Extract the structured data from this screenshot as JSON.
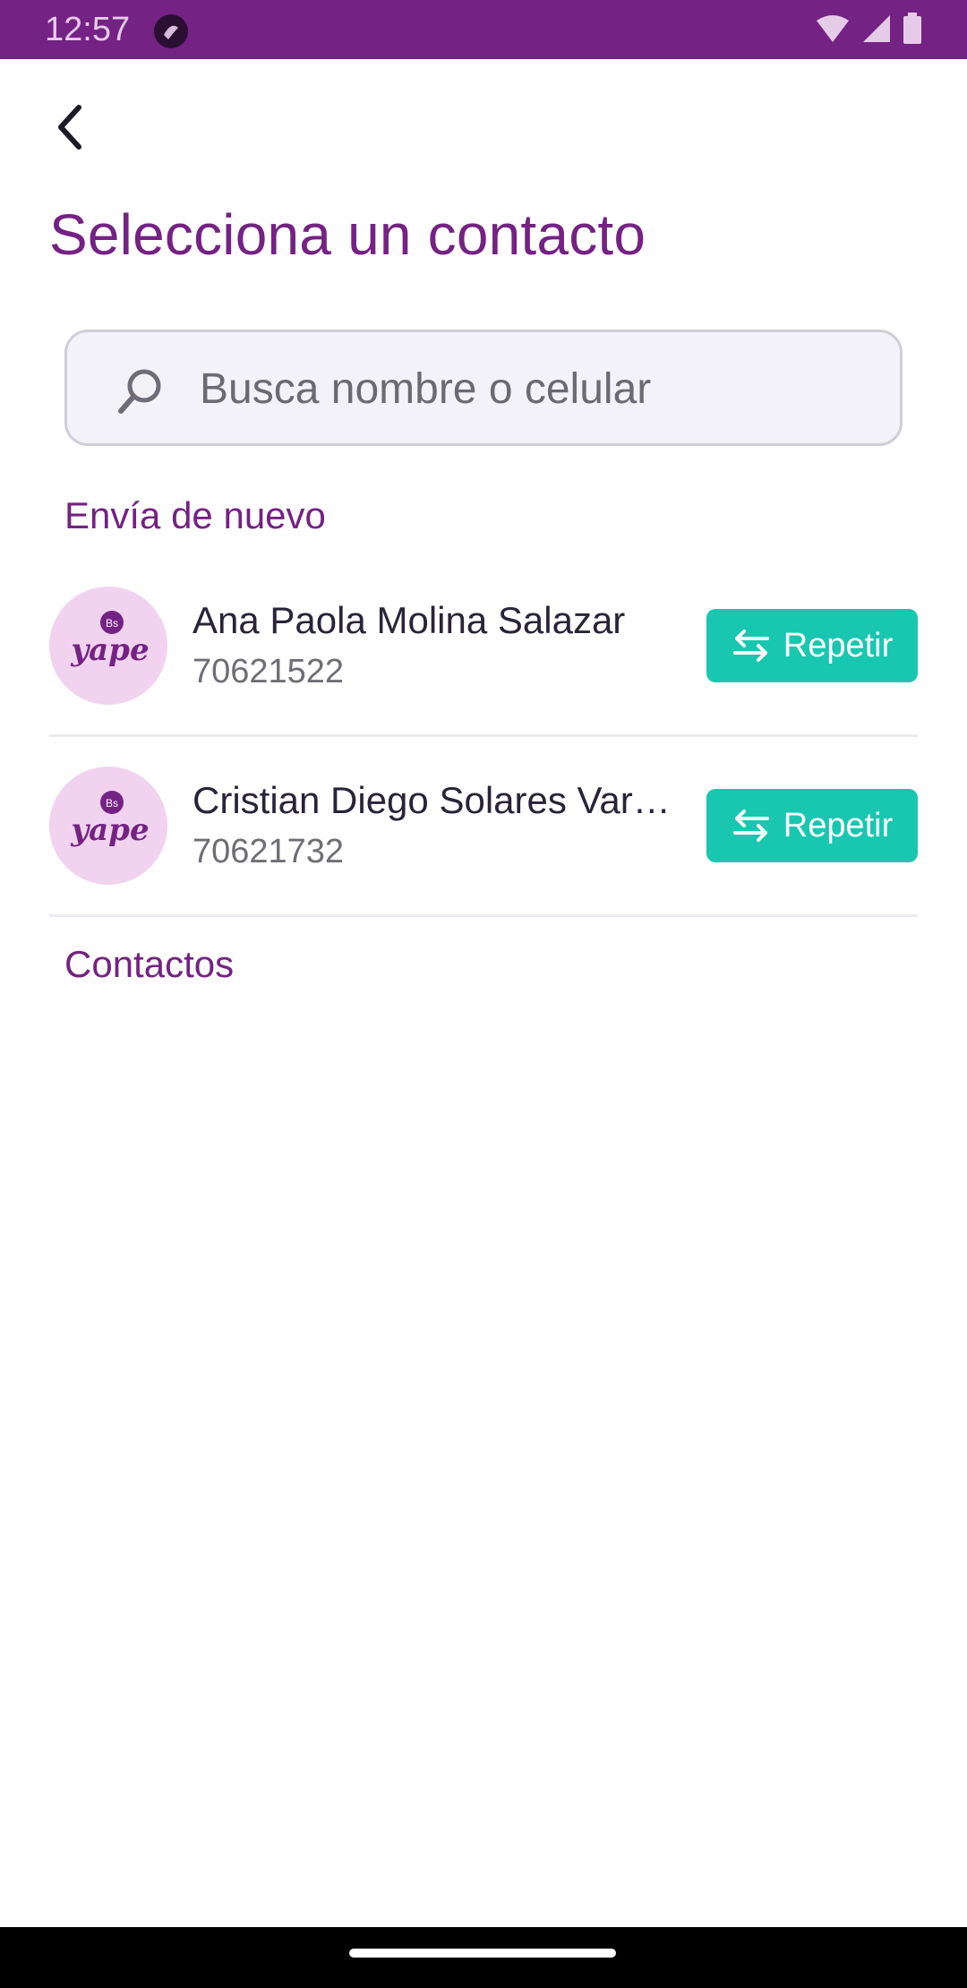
{
  "status_bar": {
    "time": "12:57",
    "background": "#742283"
  },
  "header": {
    "back_icon": "chevron-left-icon",
    "title": "Selecciona un contacto"
  },
  "search": {
    "icon": "search-icon",
    "value": "",
    "placeholder": "Busca nombre o celular"
  },
  "recent_section": {
    "label": "Envía de nuevo",
    "items": [
      {
        "avatar_icon": "yape-logo",
        "avatar_text": "yape",
        "avatar_badge": "Bs",
        "name": "Ana Paola Molina Salazar",
        "phone": "70621522",
        "action_label": "Repetir",
        "action_icon": "swap-arrows-icon"
      },
      {
        "avatar_icon": "yape-logo",
        "avatar_text": "yape",
        "avatar_badge": "Bs",
        "name": "Cristian Diego Solares Var…",
        "phone": "70621732",
        "action_label": "Repetir",
        "action_icon": "swap-arrows-icon"
      }
    ]
  },
  "contacts_section": {
    "label": "Contactos"
  },
  "colors": {
    "brand_purple": "#742283",
    "accent_teal": "#19c7b0",
    "avatar_bg": "#f1d3f0"
  }
}
